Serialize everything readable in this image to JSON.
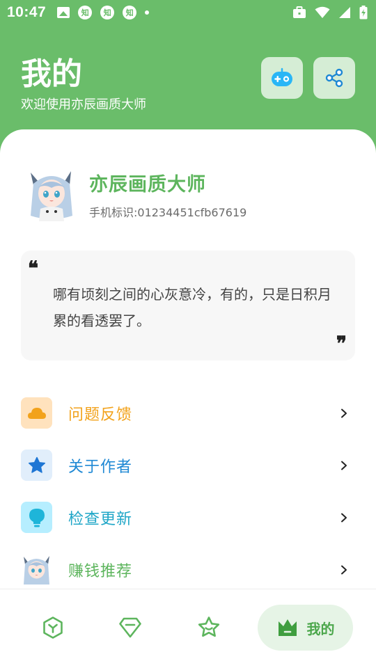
{
  "status_bar": {
    "time": "10:47",
    "left_icons": [
      "image-icon",
      "zhihu-icon",
      "zhihu-icon",
      "zhihu-icon",
      "dot-icon"
    ],
    "zhihu_label": "知",
    "right_icons": [
      "briefcase-icon",
      "wifi-icon",
      "signal-icon",
      "battery-charging-icon"
    ]
  },
  "header": {
    "title": "我的",
    "subtitle": "欢迎使用亦辰画质大师",
    "buttons": [
      "gamepad-icon",
      "share-icon"
    ]
  },
  "profile": {
    "name": "亦辰画质大师",
    "device_id": "手机标识:01234451cfb67619"
  },
  "quote": {
    "open_mark": "❝",
    "close_mark": "❞",
    "text": "哪有顷刻之间的心灰意冷，有的，只是日积月累的看透罢了。"
  },
  "menu": {
    "items": [
      {
        "label": "问题反馈",
        "icon": "cloud-icon",
        "color": "#F2A21B",
        "icon_bg": "#FFE2BD"
      },
      {
        "label": "关于作者",
        "icon": "star-icon",
        "color": "#1E88D4",
        "icon_bg": "#E1EEFB"
      },
      {
        "label": "检查更新",
        "icon": "bulb-icon",
        "color": "#1FA6C7",
        "icon_bg": "#B6EEFF"
      },
      {
        "label": "赚钱推荐",
        "icon": "anime-avatar-icon",
        "color": "#5DB55D",
        "icon_bg": "#FFFFFF"
      }
    ]
  },
  "bottom_nav": {
    "items": [
      {
        "icon": "hexagon-icon",
        "label": ""
      },
      {
        "icon": "gem-icon",
        "label": ""
      },
      {
        "icon": "star-smile-icon",
        "label": ""
      },
      {
        "icon": "crown-icon",
        "label": "我的",
        "active": true
      }
    ]
  },
  "colors": {
    "primary_green": "#6ABD6A",
    "nav_active_bg": "#E6F4E6",
    "nav_active_text": "#4CA74C"
  }
}
